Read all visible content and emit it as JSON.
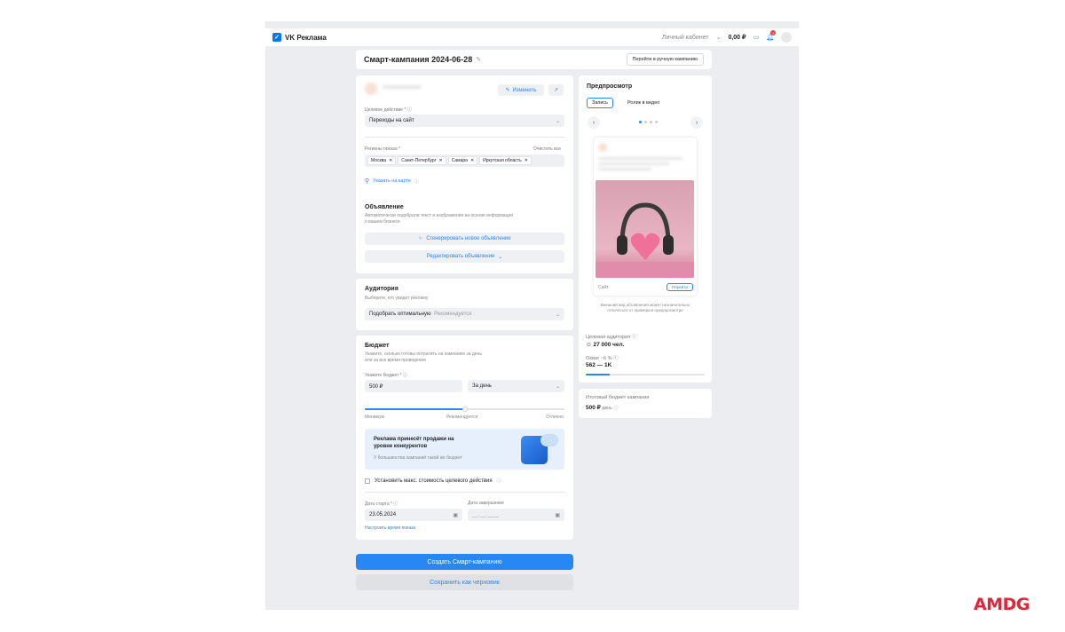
{
  "topbar": {
    "logo": "VK Реклама",
    "account": "Личный кабинет",
    "balance": "0,00 ₽",
    "notifications": "1"
  },
  "header": {
    "title": "Смарт-кампания 2024-06-28",
    "manual_btn": "Перейти в ручную кампанию"
  },
  "site_card": {
    "edit_btn": "Изменить",
    "target_label": "Целевое действие *",
    "target_value": "Переходы на сайт",
    "regions_label": "Регионы показа *",
    "clear_all": "Очистить все",
    "regions": [
      "Москва",
      "Санкт-Петербург",
      "Самара",
      "Иркутская область"
    ],
    "map_link": "Указать на карте"
  },
  "ad_card": {
    "title": "Объявление",
    "desc": "Автоматически подобрали текст и изображения на основе информации о вашем бизнесе",
    "generate_btn": "Сгенерировать новое объявление",
    "edit_btn": "Редактировать объявление"
  },
  "audience_card": {
    "title": "Аудитория",
    "desc": "Выберите, кто увидит рекламу",
    "value": "Подобрать оптимальную",
    "value_hint": " · Рекомендуется"
  },
  "budget_card": {
    "title": "Бюджет",
    "desc": "Укажите, сколько готовы потратить на кампанию за день или за все время проведения",
    "budget_label": "Укажите бюджет *",
    "budget_value": "500 ₽",
    "period_value": "За день",
    "level": 0.5,
    "scale": [
      "Минимум",
      "Рекомендуется",
      "Отлично"
    ],
    "promo_title": "Реклама принесёт продажи на уровне конкурентов",
    "promo_sub": "У большинства кампаний такой же бюджет",
    "max_cost": "Установить макс. стоимость целевого действия",
    "start_label": "Дата старта *",
    "start_value": "23.05.2024",
    "end_label": "Дата завершения",
    "end_value": "__.__.____",
    "schedule_link": "Настроить время показа"
  },
  "actions": {
    "create": "Создать Смарт-кампанию",
    "draft": "Сохранить как черновик"
  },
  "preview": {
    "title": "Предпросмотр",
    "tabs": [
      "Запись",
      "Ролик в видео"
    ],
    "ad_footer_left": "Сайт",
    "ad_footer_btn": "Перейти",
    "note": "Внешний вид объявления может незначительно отличаться от примера в предпросмотре"
  },
  "audience_stats": {
    "label": "Целевая аудитория",
    "value": "27 000 чел.",
    "reach_label": "Охват ~6 %",
    "reach_value": "562 — 1K",
    "reach_level": 0.1
  },
  "total": {
    "label": "Итоговый бюджет кампании",
    "value": "500 ₽",
    "unit": "день"
  },
  "watermark": "AMDG"
}
